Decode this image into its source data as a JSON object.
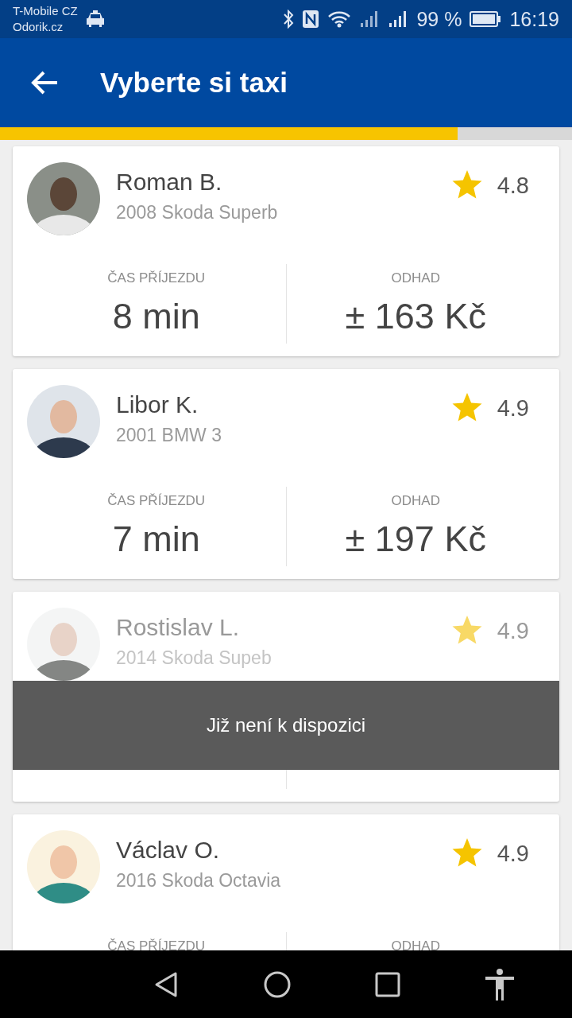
{
  "status_bar": {
    "carrier": "T-Mobile CZ",
    "operator": "Odorik.cz",
    "battery": "99 %",
    "time": "16:19"
  },
  "app_bar": {
    "title": "Vyberte si taxi"
  },
  "progress": {
    "level": 0.8
  },
  "drivers": [
    {
      "name": "Roman B.",
      "car": "2008 Skoda Superb",
      "rating": "4.8",
      "available": true,
      "eta_label": "ČAS PŘÍJEZDU",
      "eta": "8 min",
      "price_label": "ODHAD",
      "price": "± 163 Kč"
    },
    {
      "name": "Libor K.",
      "car": "2001 BMW 3",
      "rating": "4.9",
      "available": true,
      "eta_label": "ČAS PŘÍJEZDU",
      "eta": "7 min",
      "price_label": "ODHAD",
      "price": "± 197 Kč"
    },
    {
      "name": "Rostislav L.",
      "car": "2014 Skoda Supeb",
      "rating": "4.9",
      "available": false,
      "notice": "Již není k dispozici"
    },
    {
      "name": "Václav O.",
      "car": "2016 Skoda Octavia",
      "rating": "4.9",
      "available": true,
      "eta_label": "ČAS PŘÍJEZDU",
      "price_label": "ODHAD"
    }
  ]
}
